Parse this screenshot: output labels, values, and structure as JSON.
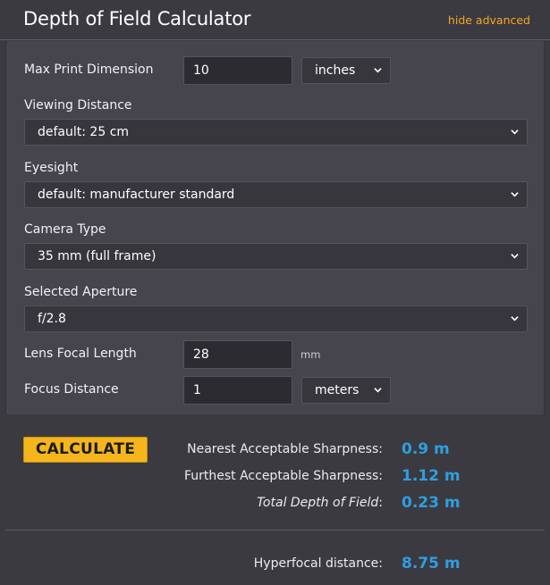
{
  "header": {
    "title": "Depth of Field Calculator",
    "toggle_advanced": "hide advanced"
  },
  "form": {
    "max_print": {
      "label": "Max Print Dimension",
      "value": "10",
      "unit": "inches"
    },
    "viewing_distance": {
      "label": "Viewing Distance",
      "selected": "default: 25 cm"
    },
    "eyesight": {
      "label": "Eyesight",
      "selected": "default: manufacturer standard"
    },
    "camera_type": {
      "label": "Camera Type",
      "selected": "35 mm (full frame)"
    },
    "aperture": {
      "label": "Selected Aperture",
      "selected": "f/2.8"
    },
    "focal_length": {
      "label": "Lens Focal Length",
      "value": "28",
      "unit": "mm"
    },
    "focus_distance": {
      "label": "Focus Distance",
      "value": "1",
      "unit": "meters"
    }
  },
  "results": {
    "calculate_label": "CALCULATE",
    "nearest": {
      "label": "Nearest Acceptable Sharpness:",
      "value": "0.9 m"
    },
    "furthest": {
      "label": "Furthest Acceptable Sharpness:",
      "value": "1.12 m"
    },
    "total": {
      "label": "Total Depth of Field",
      "colon": ":",
      "value": "0.23 m"
    },
    "hyperfocal": {
      "label": "Hyperfocal distance:",
      "value": "8.75 m"
    }
  },
  "colors": {
    "accent": "#f5a623",
    "button": "#f5b51c",
    "value": "#2e9fe0",
    "panel": "#46444d",
    "background": "#3b3a41"
  },
  "icons": {
    "select_arrow": "chevron-down-icon"
  }
}
